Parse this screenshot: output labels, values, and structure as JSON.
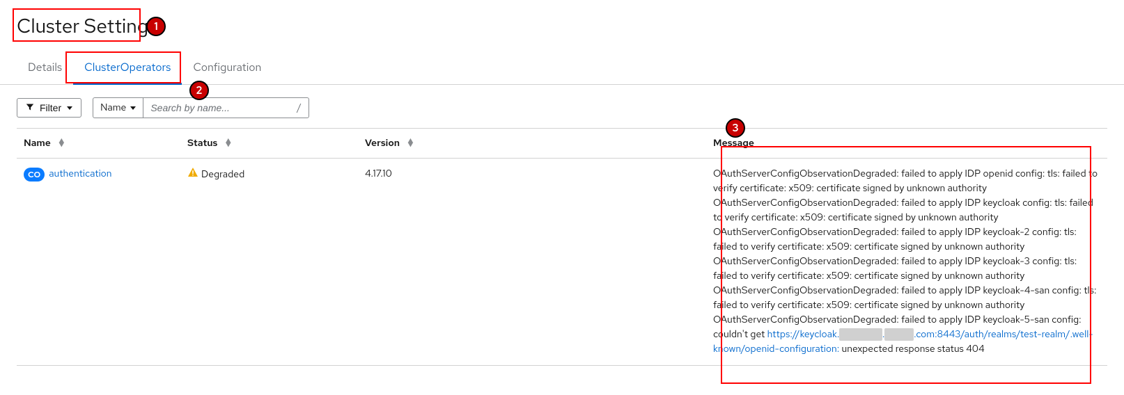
{
  "page": {
    "title": "Cluster Settings"
  },
  "tabs": {
    "details": "Details",
    "operators": "ClusterOperators",
    "configuration": "Configuration"
  },
  "toolbar": {
    "filter_label": "Filter",
    "name_label": "Name",
    "search_placeholder": "Search by name...",
    "slash": "/"
  },
  "table": {
    "headers": {
      "name": "Name",
      "status": "Status",
      "version": "Version",
      "message": "Message"
    },
    "rows": [
      {
        "badge": "CO",
        "name": "authentication",
        "status": "Degraded",
        "version": "4.17.10",
        "message_p1": "OAuthServerConfigObservationDegraded: failed to apply IDP openid config: tls: failed to verify certificate: x509: certificate signed by unknown authority OAuthServerConfigObservationDegraded: failed to apply IDP keycloak config: tls: failed to verify certificate: x509: certificate signed by unknown authority OAuthServerConfigObservationDegraded: failed to apply IDP keycloak-2 config: tls: failed to verify certificate: x509: certificate signed by unknown authority OAuthServerConfigObservationDegraded: failed to apply IDP keycloak-3 config: tls: failed to verify certificate: x509: certificate signed by unknown authority OAuthServerConfigObservationDegraded: failed to apply IDP keycloak-4-san config: tls: failed to verify certificate: x509: certificate signed by unknown authority OAuthServerConfigObservationDegraded: failed to apply IDP keycloak-5-san config: couldn't get ",
        "message_link_pre": "https://keycloak.",
        "message_link_redacted": "██████",
        "message_link_mid": ".",
        "message_link_redacted2": "████",
        "message_link_post": ".com:8443/auth/realms/test-realm/.well-known/openid-configuration:",
        "message_p2": " unexpected response status 404"
      }
    ]
  },
  "annotations": {
    "a1": "1",
    "a2": "2",
    "a3": "3"
  }
}
